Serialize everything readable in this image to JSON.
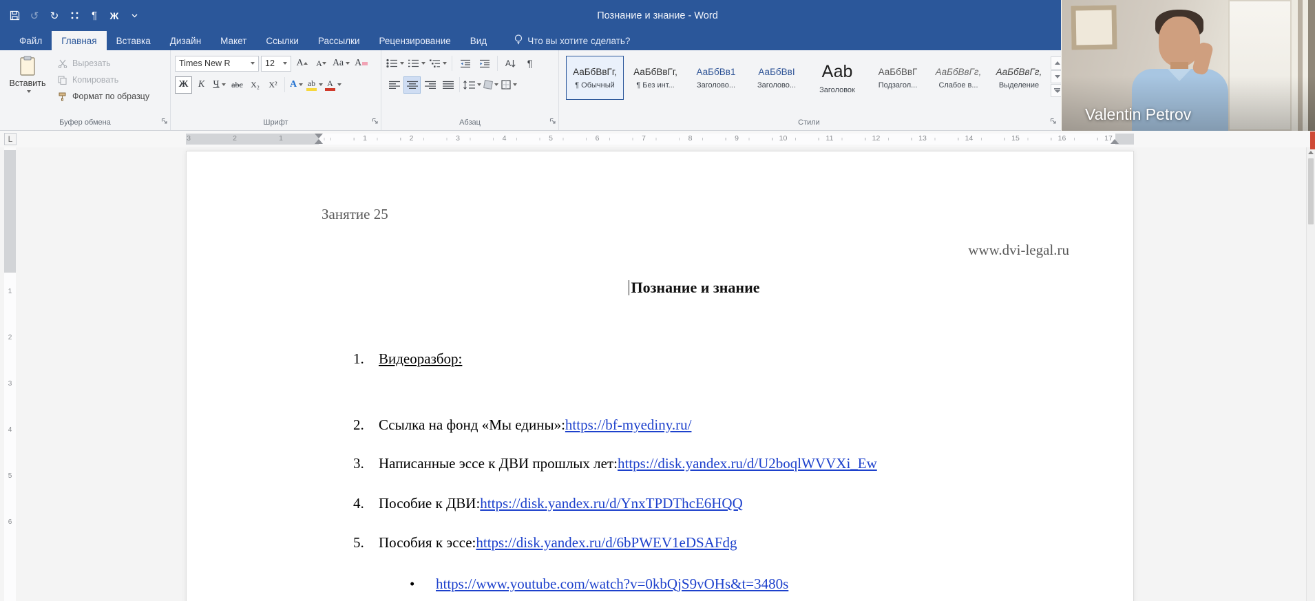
{
  "window": {
    "title": "Познание и знание - Word"
  },
  "qat": {
    "pilcrow": "¶",
    "bold": "Ж"
  },
  "tabs": [
    "Файл",
    "Главная",
    "Вставка",
    "Дизайн",
    "Макет",
    "Ссылки",
    "Рассылки",
    "Рецензирование",
    "Вид"
  ],
  "tellme": "Что вы хотите сделать?",
  "ribbon": {
    "clipboard": {
      "group": "Буфер обмена",
      "paste": "Вставить",
      "cut": "Вырезать",
      "copy": "Копировать",
      "format_painter": "Формат по образцу"
    },
    "font": {
      "group": "Шрифт",
      "name": "Times New R",
      "size": "12",
      "grow": "А",
      "shrink": "А",
      "case": "Аа",
      "clear": "А",
      "bold": "Ж",
      "italic": "К",
      "underline": "Ч",
      "strike": "abc",
      "sub": "Х₂",
      "sup": "Х²",
      "effects": "А",
      "highlight": "ab",
      "color": "А"
    },
    "paragraph": {
      "group": "Абзац",
      "sort": "А",
      "pilcrow": "¶"
    },
    "styles": {
      "group": "Стили",
      "items": [
        {
          "preview": "АаБбВвГг,",
          "label": "¶ Обычный"
        },
        {
          "preview": "АаБбВвГг,",
          "label": "¶ Без инт..."
        },
        {
          "preview": "АаБбВв1",
          "label": "Заголово..."
        },
        {
          "preview": "АаБбВвI",
          "label": "Заголово..."
        },
        {
          "preview": "Ааb",
          "label": "Заголовок"
        },
        {
          "preview": "АаБбВвГ",
          "label": "Подзагол..."
        },
        {
          "preview": "АаБбВвГг,",
          "label": "Слабое в..."
        },
        {
          "preview": "АаБбВвГг,",
          "label": "Выделение"
        }
      ]
    }
  },
  "ruler": {
    "tab_selector": "L",
    "left": [
      "3",
      "2",
      "1"
    ],
    "right": [
      "1",
      "2",
      "3",
      "4",
      "5",
      "6",
      "7",
      "8",
      "9",
      "10",
      "11",
      "12",
      "13",
      "14",
      "15",
      "16",
      "17"
    ],
    "vertical": [
      "1",
      "2",
      "3",
      "4",
      "5",
      "6"
    ]
  },
  "document": {
    "lesson": "Занятие 25",
    "site": "www.dvi-legal.ru",
    "title": "Познание и знание",
    "items": [
      {
        "num": "1.",
        "text": "Видеоразбор:",
        "link": ""
      },
      {
        "num": "2.",
        "text": "Ссылка на фонд «Мы едины»: ",
        "link": "https://bf-myediny.ru/"
      },
      {
        "num": "3.",
        "text": "Написанные эссе к ДВИ прошлых лет: ",
        "link": "https://disk.yandex.ru/d/U2boqlWVVXi_Ew"
      },
      {
        "num": "4.",
        "text": "Пособие к ДВИ: ",
        "link": "https://disk.yandex.ru/d/YnxTPDThcE6HQQ"
      },
      {
        "num": "5.",
        "text": "Пособия к эссе: ",
        "link": "https://disk.yandex.ru/d/6bPWEV1eDSAFdg"
      }
    ],
    "bullet": "•",
    "bullet_link": "https://www.youtube.com/watch?v=0kbQjS9vOHs&t=3480s"
  },
  "webcam": {
    "name": "Valentin Petrov"
  },
  "colors": {
    "titlebar": "#2b579a",
    "link": "#1d41cc",
    "accent": "#2b579a"
  }
}
